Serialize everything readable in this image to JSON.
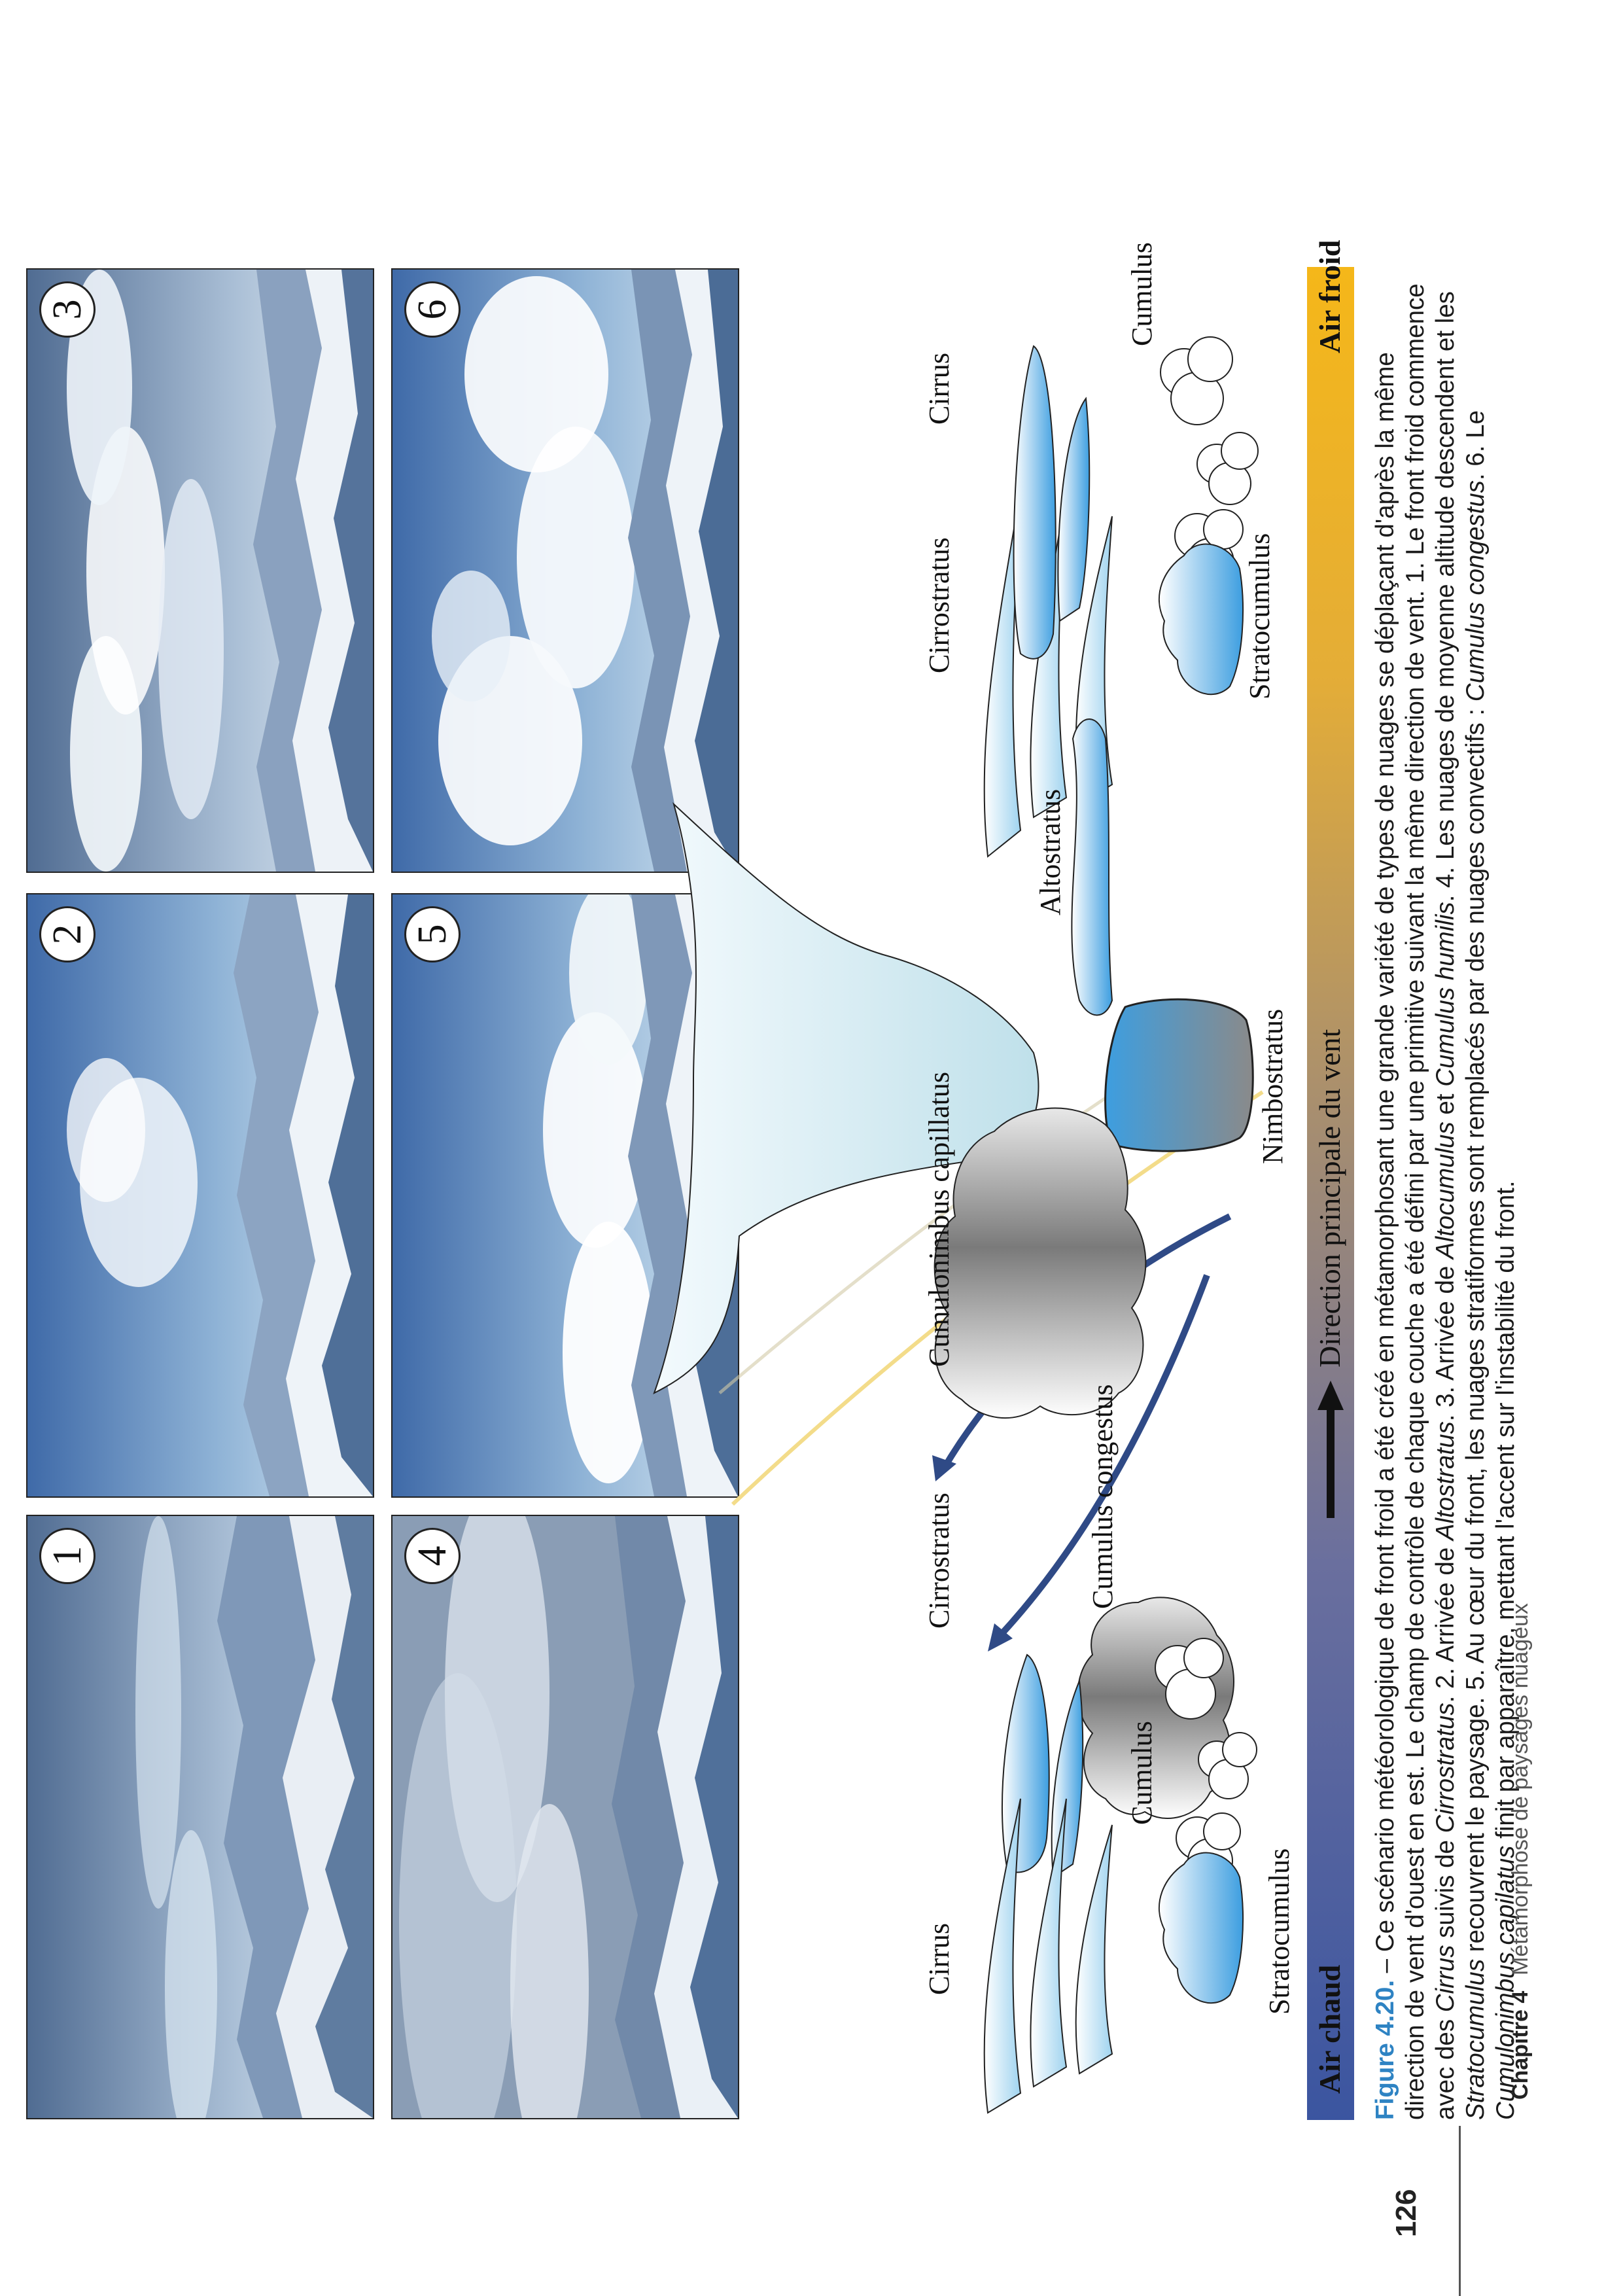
{
  "photos": [
    {
      "number": "1"
    },
    {
      "number": "2"
    },
    {
      "number": "3"
    },
    {
      "number": "4"
    },
    {
      "number": "5"
    },
    {
      "number": "6"
    }
  ],
  "clouds_left": {
    "cirrus": "Cirrus",
    "cirrostratus": "Cirrostratus",
    "altostratus": "Altostratus",
    "nimbostratus": "Nimbostratus",
    "cumulus": "Cumulus",
    "stratocumulus": "Stratocumulus"
  },
  "clouds_center": {
    "cumulonimbus": "Cumulonimbus capillatus",
    "congestus": "Cumulus congestus"
  },
  "clouds_right": {
    "cirrostratus": "Cirrostratus",
    "cirrus": "Cirrus",
    "cumulus": "Cumulus",
    "stratocumulus": "Stratocumulus"
  },
  "band": {
    "cold": "Air froid",
    "direction": "Direction principale du vent",
    "warm": "Air chaud",
    "colors": [
      "#3b55a0",
      "#f5b719"
    ]
  },
  "caption": {
    "label": "Figure 4.20.",
    "segments": [
      " – Ce scénario météorologique de front froid a été créé en métamorphosant une grande variété de types de nuages se déplaçant d'après la même direction de vent d'ouest en est. Le champ de contrôle de chaque couche a été défini par une primitive suivant la même direction de vent. 1. Le front froid commence avec des ",
      "Cirrus",
      " suivis de ",
      "Cirrostratus",
      ". 2. Arrivée de ",
      "Altostratus",
      ". 3. Arrivée de ",
      "Altocumulus",
      " et ",
      "Cumulus humilis",
      ". 4. Les nuages de moyenne altitude descendent et les ",
      "Stratocumulus",
      " recouvrent le paysage. 5. Au cœur du front, les nuages stratiformes sont remplacés par des nuages convectifs : ",
      "Cumulus congestus",
      ". 6. Le ",
      "Cumulonimbus capilatus",
      " finit par apparaître, mettant l'accent sur l'instabilité du front."
    ]
  },
  "footer": {
    "page_number": "126",
    "chapter_label": "Chapitre 4",
    "chapter_title": "Métamorphose de paysages nuageux"
  }
}
